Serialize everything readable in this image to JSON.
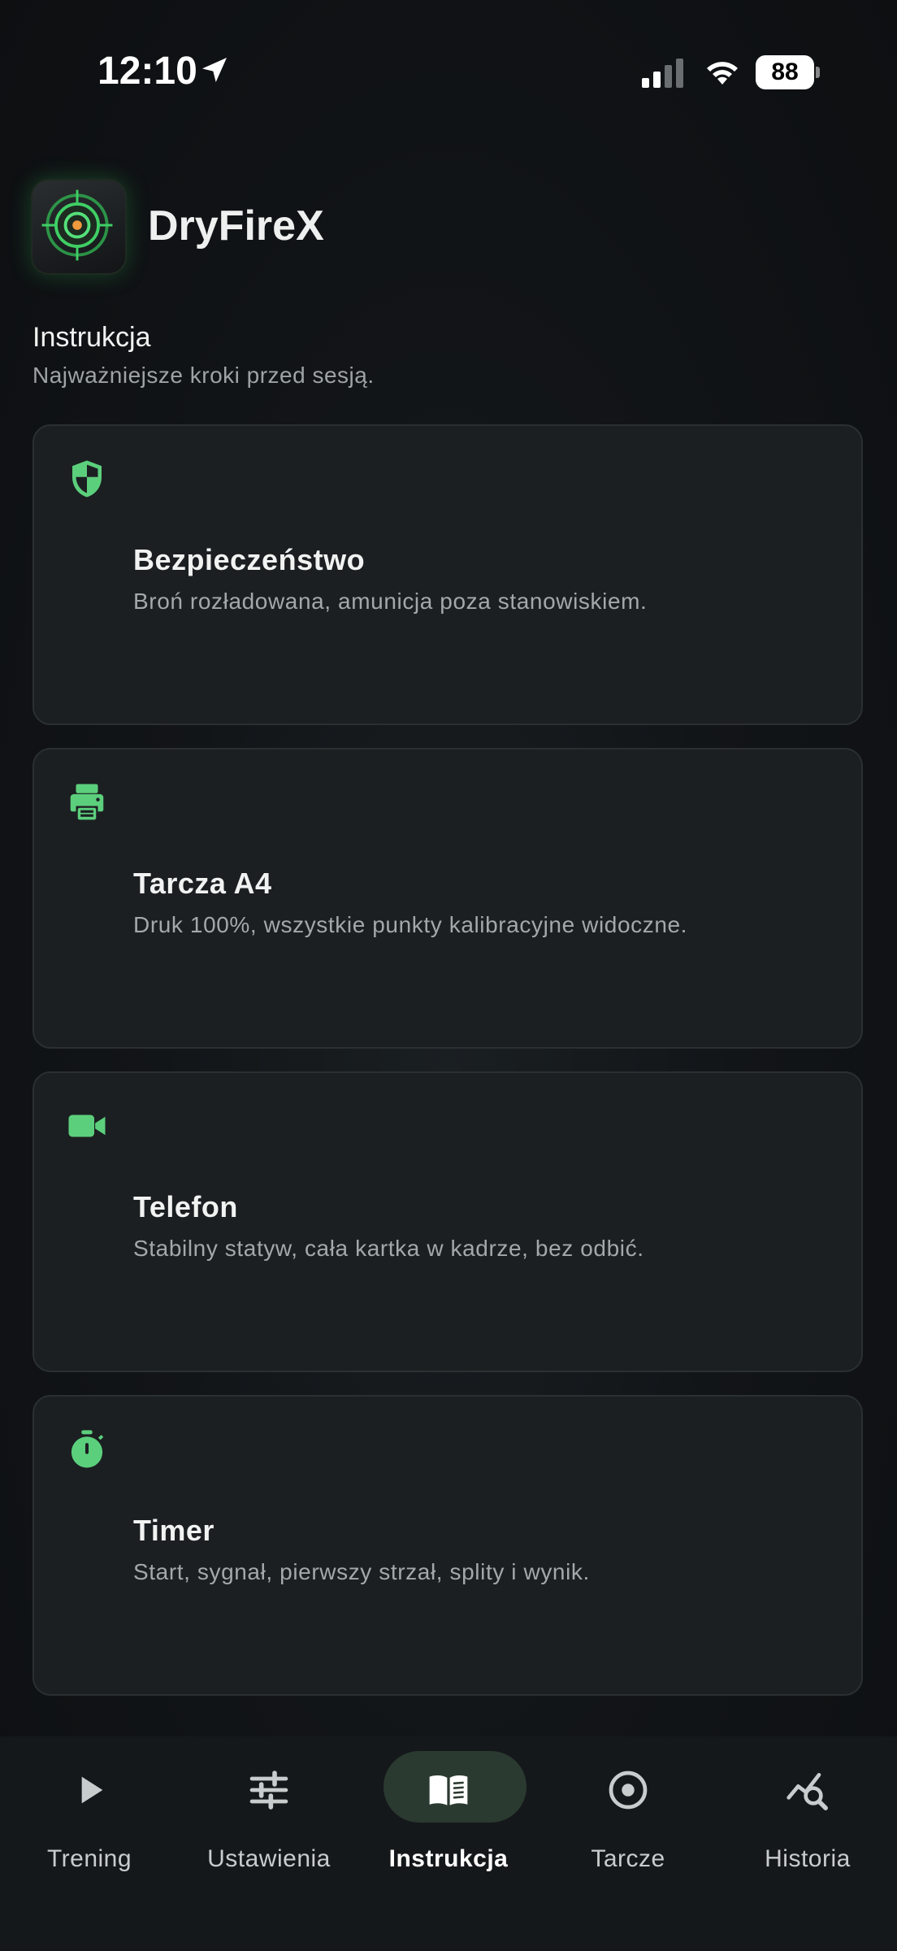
{
  "status_bar": {
    "time": "12:10",
    "battery": "88"
  },
  "header": {
    "app_name": "DryFireX",
    "logo": "target-logo-icon"
  },
  "section": {
    "title": "Instrukcja",
    "subtitle": "Najważniejsze kroki przed sesją."
  },
  "cards": [
    {
      "icon": "shield-icon",
      "title": "Bezpieczeństwo",
      "description": "Broń rozładowana, amunicja poza stanowiskiem."
    },
    {
      "icon": "printer-icon",
      "title": "Tarcza A4",
      "description": "Druk 100%, wszystkie punkty kalibracyjne widoczne."
    },
    {
      "icon": "video-camera-icon",
      "title": "Telefon",
      "description": "Stabilny statyw, cała kartka w kadrze, bez odbić."
    },
    {
      "icon": "stopwatch-icon",
      "title": "Timer",
      "description": "Start, sygnał, pierwszy strzał, splity i wynik."
    }
  ],
  "tab_bar": {
    "active": "Instrukcja",
    "tabs": [
      {
        "label": "Trening",
        "icon": "play-icon"
      },
      {
        "label": "Ustawienia",
        "icon": "sliders-icon"
      },
      {
        "label": "Instrukcja",
        "icon": "book-icon"
      },
      {
        "label": "Tarcze",
        "icon": "target-icon"
      },
      {
        "label": "Historia",
        "icon": "chart-search-icon"
      }
    ]
  },
  "colors": {
    "accent": "#5ccf7c",
    "card_bg": "#1b1f22",
    "active_tab_pill": "#2b3a30"
  }
}
